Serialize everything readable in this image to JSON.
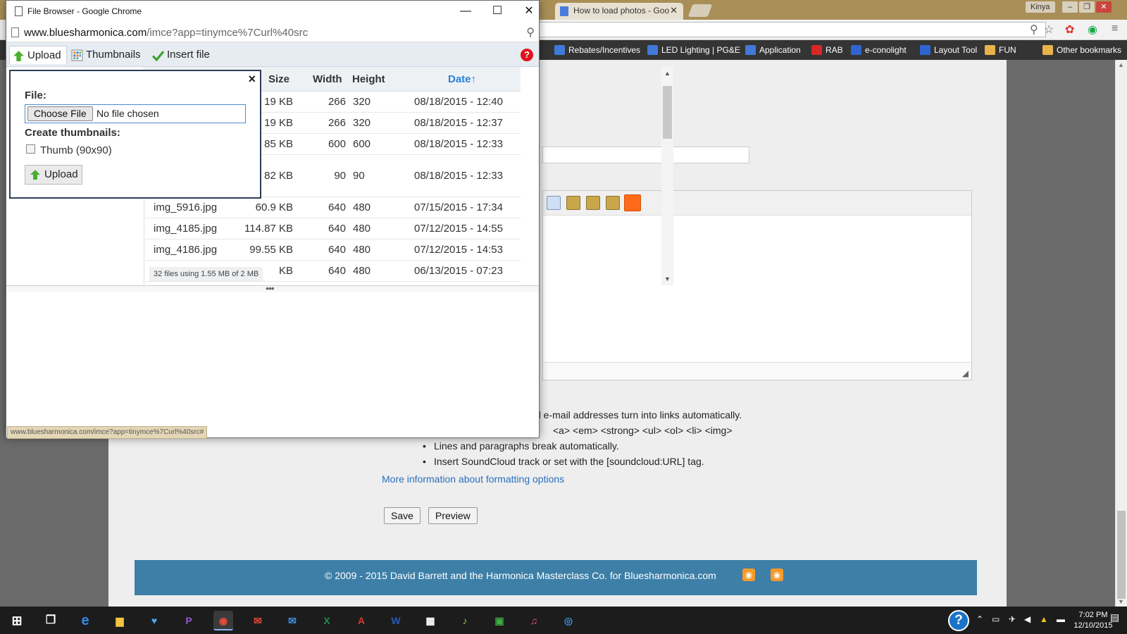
{
  "back_window": {
    "tabs": [
      {
        "label": "How to load photos - Goo",
        "close": "✕"
      }
    ],
    "user_badge": "Kinya",
    "window_controls": [
      "–",
      "❐",
      "✕"
    ],
    "bookmarks": [
      {
        "label": "Rebates/Incentives",
        "color": "#3f7ad8"
      },
      {
        "label": "LED Lighting | PG&E",
        "color": "#3f7ad8"
      },
      {
        "label": "Application",
        "color": "#3f7ad8"
      },
      {
        "label": "RAB",
        "color": "#d62828"
      },
      {
        "label": "e-conolight",
        "color": "#2e65d1"
      },
      {
        "label": "Layout Tool",
        "color": "#2e65d1"
      },
      {
        "label": "FUN",
        "color": "#e8b44a"
      },
      {
        "label": "Other bookmarks",
        "color": "#e8b44a"
      }
    ]
  },
  "page": {
    "tips": [
      "d e-mail addresses turn into links automatically.",
      "<a> <em> <strong> <ul> <ol> <li> <img>",
      "Lines and paragraphs break automatically.",
      "Insert SoundCloud track or set with the [soundcloud:URL] tag."
    ],
    "more_info": "More information about formatting options",
    "save": "Save",
    "preview": "Preview",
    "footer": "© 2009 - 2015 David Barrett and the Harmonica Masterclass Co. for Bluesharmonica.com"
  },
  "popup": {
    "title": "File Browser - Google Chrome",
    "url_host": "www.bluesharmonica.com",
    "url_rest": "/imce?app=tinymce%7Curl%40src",
    "ops": {
      "upload": "Upload",
      "thumbnails": "Thumbnails",
      "insert": "Insert file"
    },
    "help": "?",
    "columns": {
      "size": "Size",
      "width": "Width",
      "height": "Height",
      "date": "Date↑"
    },
    "files": [
      {
        "name": "",
        "size": "19 KB",
        "width": "266",
        "height": "320",
        "date": "08/18/2015 - 12:40"
      },
      {
        "name": "",
        "size": "19 KB",
        "width": "266",
        "height": "320",
        "date": "08/18/2015 - 12:37"
      },
      {
        "name": "",
        "size": "85 KB",
        "width": "600",
        "height": "600",
        "date": "08/18/2015 - 12:33"
      },
      {
        "name": "",
        "size": "82 KB",
        "width": "90",
        "height": "90",
        "date": "08/18/2015 - 12:33"
      },
      {
        "name": "img_5916.jpg",
        "size": "60.9 KB",
        "width": "640",
        "height": "480",
        "date": "07/15/2015 - 17:34"
      },
      {
        "name": "img_4185.jpg",
        "size": "114.87 KB",
        "width": "640",
        "height": "480",
        "date": "07/12/2015 - 14:55"
      },
      {
        "name": "img_4186.jpg",
        "size": "99.55 KB",
        "width": "640",
        "height": "480",
        "date": "07/12/2015 - 14:53"
      },
      {
        "name": "",
        "size": "KB",
        "width": "640",
        "height": "480",
        "date": "06/13/2015 - 07:23"
      }
    ],
    "status": "32 files using 1.55 MB of 2 MB",
    "status_url": "www.bluesharmonica.com/imce?app=tinymce%7Curl%40src#",
    "upload_form": {
      "close": "×",
      "file_label": "File:",
      "choose": "Choose File",
      "no_file": "No file chosen",
      "thumbs_label": "Create thumbnails:",
      "thumb_option": "Thumb (90x90)",
      "thumb_checked": false,
      "upload": "Upload"
    }
  },
  "taskbar": {
    "apps": [
      "start-icon",
      "task-view-icon",
      "edge-icon",
      "file-explorer-icon",
      "heart-app-icon",
      "pandora-icon",
      "chrome-icon",
      "gmail-icon",
      "mail-icon",
      "excel-icon",
      "acrobat-icon",
      "word-icon",
      "calculator-icon",
      "music-app-icon",
      "pc-app-icon",
      "itunes-icon",
      "media-app-icon"
    ],
    "time": "7:02 PM",
    "date": "12/10/2015"
  }
}
